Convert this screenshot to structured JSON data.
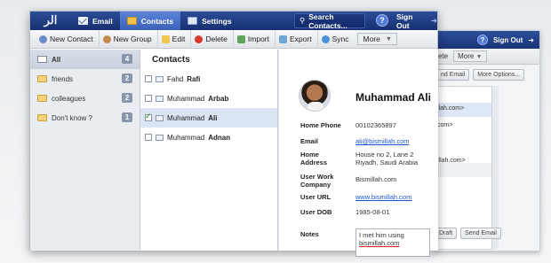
{
  "app": {
    "logo_glyph": "الر"
  },
  "nav": {
    "tabs": [
      {
        "label": "Email",
        "icon": "envelope-icon"
      },
      {
        "label": "Contacts",
        "icon": "contacts-icon",
        "active": true
      },
      {
        "label": "Settings",
        "icon": "settings-icon"
      }
    ],
    "search_label": "Search Contacts...",
    "help_label": "?",
    "signout_label": "Sign Out"
  },
  "toolbar": {
    "new_contact": "New Contact",
    "new_group": "New Group",
    "edit": "Edit",
    "delete": "Delete",
    "import": "Import",
    "export": "Export",
    "sync": "Sync",
    "more": "More"
  },
  "groups": [
    {
      "label": "All",
      "count": "4",
      "selected": true
    },
    {
      "label": "friends",
      "count": "2"
    },
    {
      "label": "colleagues",
      "count": "2"
    },
    {
      "label": "Don't know ?",
      "count": "1"
    }
  ],
  "contacts": {
    "heading": "Contacts",
    "items": [
      {
        "first": "Fahd",
        "last": "Rafi",
        "checked": false
      },
      {
        "first": "Muhammad",
        "last": "Arbab",
        "checked": false
      },
      {
        "first": "Muhammad",
        "last": "Ali",
        "checked": true
      },
      {
        "first": "Muhammad",
        "last": "Adnan",
        "checked": false
      }
    ]
  },
  "detail": {
    "name": "Muhammad Ali",
    "fields": {
      "home_phone_label": "Home Phone",
      "home_phone": "00102365897",
      "email_label": "Email",
      "email": "ali@bismillah.com",
      "home_address_label_1": "Home",
      "home_address_label_2": "Address",
      "home_address_1": "House no 2, Lane 2",
      "home_address_2": "Riyadh, Saudi Arabia",
      "work_label_1": "User Work",
      "work_label_2": "Company",
      "work": "Bismillah.com",
      "url_label": "User URL",
      "url": "www.bismillah.com",
      "dob_label": "User DOB",
      "dob": "1985-08-01",
      "notes_label": "Notes",
      "notes_1": "I met him using",
      "notes_2": "bismillah.com"
    }
  },
  "background_window": {
    "delete_partial": "ete",
    "more": "More",
    "send_email": "nd Email",
    "more_options": "More Options...",
    "line1": "llah.com>",
    "line2": "com>",
    "line3": "illah.com>",
    "draft": "Draft",
    "send": "Send Email",
    "signout": "Sign Out",
    "help": "?"
  }
}
